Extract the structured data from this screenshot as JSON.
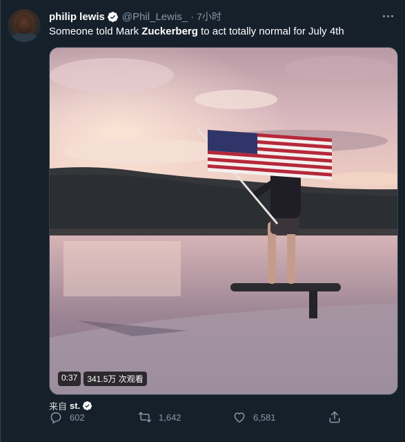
{
  "tweet": {
    "author": {
      "name": "philip lewis",
      "handle": "@Phil_Lewis_",
      "separator": "·",
      "time": "7小时"
    },
    "text": {
      "part1": "Someone told Mark ",
      "bold": "Zuckerberg",
      "part2": " to act totally normal for July 4th"
    },
    "video": {
      "duration": "0:37",
      "views": "341.5万 次观看"
    },
    "source": {
      "prefix": "来自",
      "app": "st."
    },
    "actions": {
      "replies": "602",
      "retweets": "1,642",
      "likes": "6,581"
    }
  },
  "colors": {
    "background": "#15202b",
    "secondary_text": "#8899a6",
    "verified_blue": "#ffffff"
  },
  "icons": [
    "verified-icon",
    "more-icon",
    "reply-icon",
    "retweet-icon",
    "like-icon",
    "share-icon"
  ]
}
